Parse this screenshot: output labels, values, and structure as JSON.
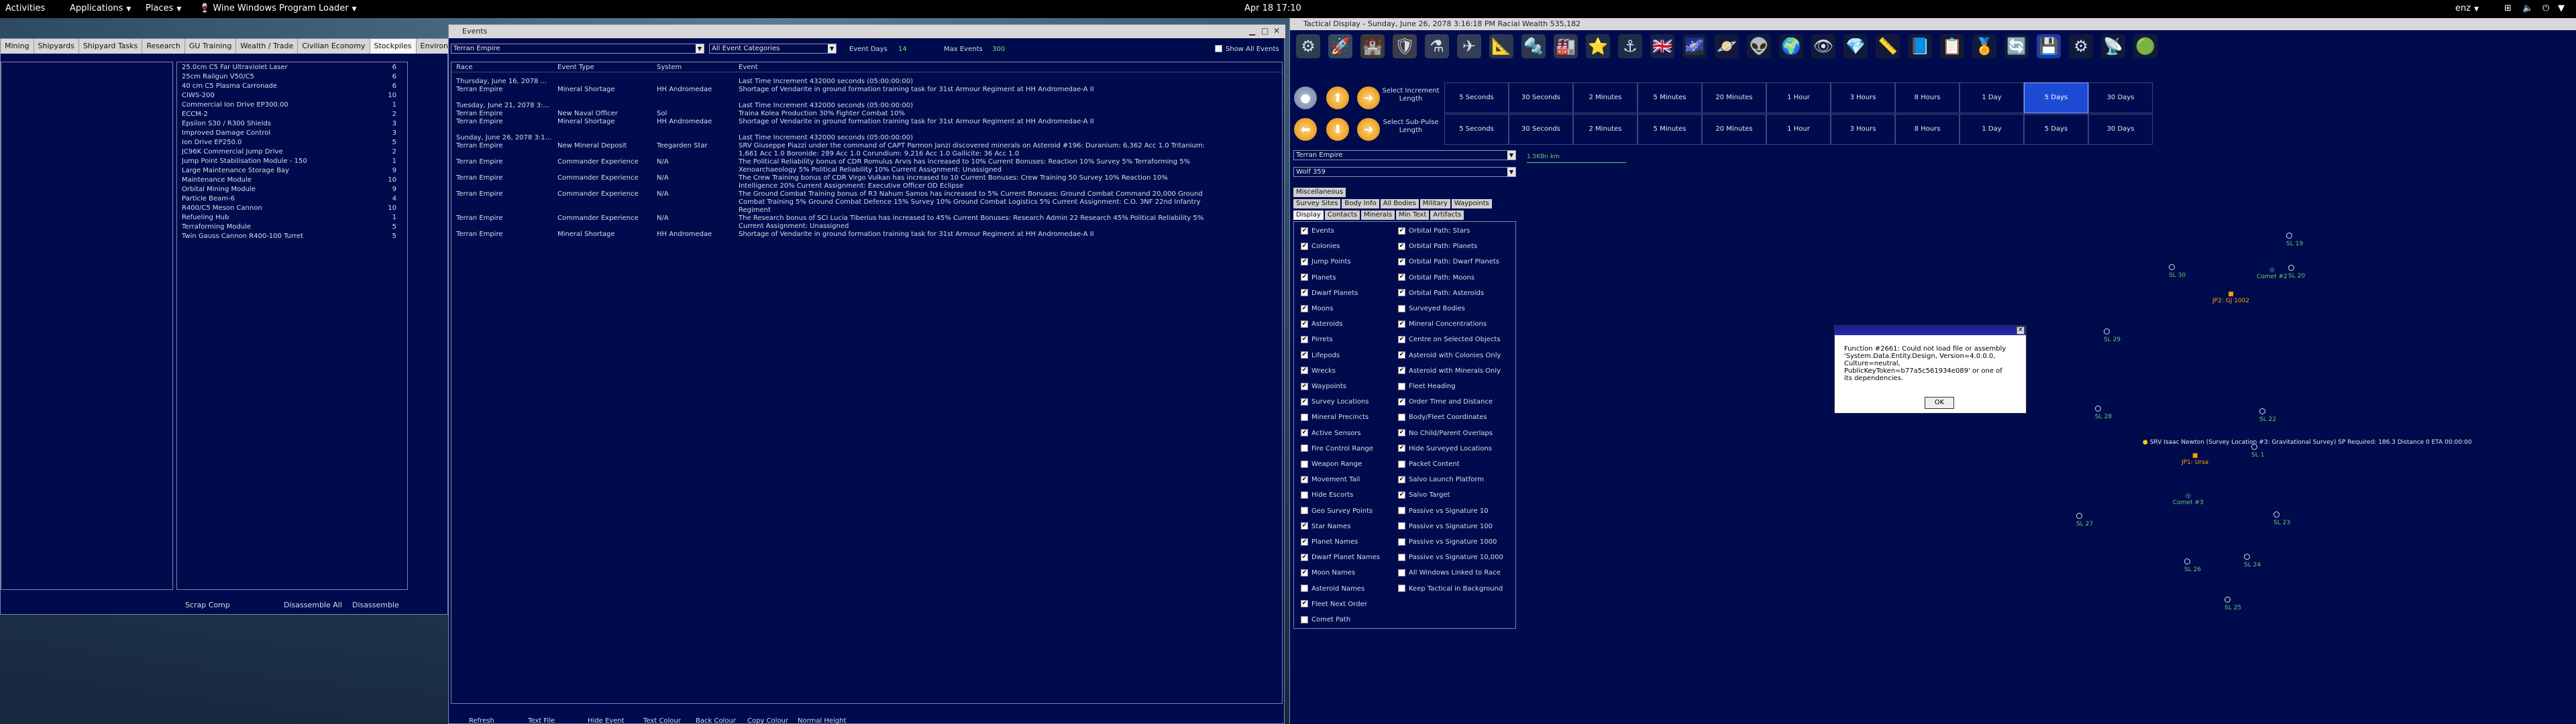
{
  "topbar": {
    "activities": "Activities",
    "applications": "Applications",
    "places": "Places",
    "wine": "Wine Windows Program Loader",
    "clock": "Apr 18  17:10",
    "lang": "enz"
  },
  "left_window": {
    "tabs": [
      "Mining",
      "Shipyards",
      "Shipyard Tasks",
      "Research",
      "GU Training",
      "Wealth / Trade",
      "Civilian Economy",
      "Stockpiles",
      "Environme"
    ],
    "components": [
      {
        "name": "25.0cm C5 Far Ultraviolet Laser",
        "qty": "6"
      },
      {
        "name": "25cm Railgun V50/C5",
        "qty": "6"
      },
      {
        "name": "40 cm C5 Plasma Carronade",
        "qty": "6"
      },
      {
        "name": "CIWS-200",
        "qty": "10"
      },
      {
        "name": "Commercial Ion Drive  EP300.00",
        "qty": "1"
      },
      {
        "name": "ECCM-2",
        "qty": "2"
      },
      {
        "name": "Epsilon S30 / R300 Shields",
        "qty": "3"
      },
      {
        "name": "Improved Damage Control",
        "qty": "3"
      },
      {
        "name": "Ion Drive  EP250.0",
        "qty": "5"
      },
      {
        "name": "JC96K Commercial Jump Drive",
        "qty": "2"
      },
      {
        "name": "Jump Point Stabilisation Module - 150",
        "qty": "1"
      },
      {
        "name": "Large Maintenance Storage Bay",
        "qty": "9"
      },
      {
        "name": "Maintenance Module",
        "qty": "10"
      },
      {
        "name": "Orbital Mining Module",
        "qty": "9"
      },
      {
        "name": "Particle Beam-6",
        "qty": "4"
      },
      {
        "name": "R400/C5 Meson Cannon",
        "qty": "10"
      },
      {
        "name": "Refueling Hub",
        "qty": "1"
      },
      {
        "name": "Terraforming Module",
        "qty": "5"
      },
      {
        "name": "Twin Gauss Cannon R400-100 Turret",
        "qty": "5"
      }
    ],
    "buttons": {
      "scrap": "Scrap Comp",
      "disassemble_all": "Disassemble All",
      "disassemble": "Disassemble"
    }
  },
  "events_window": {
    "title": "Events",
    "race_filter": "Terran Empire",
    "category_filter": "All Event Categories",
    "event_days_label": "Event Days",
    "event_days_value": "14",
    "max_events_label": "Max Events",
    "max_events_value": "300",
    "show_all_label": "Show All Events",
    "columns": {
      "race": "Race",
      "event_type": "Event Type",
      "system": "System",
      "event": "Event"
    },
    "rows": [
      {
        "race": "Thursday, June 16, 2078 ...",
        "type": "",
        "system": "",
        "event": "Last Time Increment 432000 seconds (05:00:00:00)"
      },
      {
        "race": "Terran Empire",
        "type": "Mineral Shortage",
        "system": "HH Andromedae",
        "event": "Shortage of Vendarite in ground formation training task for 31st Armour Regiment at HH Andromedae-A II"
      },
      {
        "race": "",
        "type": "",
        "system": "",
        "event": ""
      },
      {
        "race": "Tuesday, June 21, 2078 3:...",
        "type": "",
        "system": "",
        "event": "Last Time Increment 432000 seconds (05:00:00:00)"
      },
      {
        "race": "Terran Empire",
        "type": "New Naval Officer",
        "system": "Sol",
        "event": "Traina Kolea   Production 30%   Fighter Combat 10%"
      },
      {
        "race": "Terran Empire",
        "type": "Mineral Shortage",
        "system": "HH Andromedae",
        "event": "Shortage of Vendarite in ground formation training task for 31st Armour Regiment at HH Andromedae-A II"
      },
      {
        "race": "",
        "type": "",
        "system": "",
        "event": ""
      },
      {
        "race": "Sunday, June 26, 2078 3:1...",
        "type": "",
        "system": "",
        "event": "Last Time Increment 432000 seconds (05:00:00:00)"
      },
      {
        "race": "Terran Empire",
        "type": "New Mineral Deposit",
        "system": "Teegarden Star",
        "event": "SRV Giuseppe Piazzi under the command of CAPT Parmon Janzi discovered minerals on Asteroid #196:   Duranium: 6,362  Acc 1.0    Tritanium:"
      },
      {
        "race": "",
        "type": "",
        "system": "",
        "event": "1,661  Acc 1.0    Boronide: 289  Acc 1.0    Corundium: 9,216  Acc 1.0    Gallicite: 36  Acc 1.0"
      },
      {
        "race": "Terran Empire",
        "type": "Commander Experience",
        "system": "N/A",
        "event": "The Political Reliability bonus of CDR Romulus Arvis has increased to 10%    Current Bonuses:  Reaction 10%    Survey 5%    Terraforming 5%"
      },
      {
        "race": "",
        "type": "",
        "system": "",
        "event": "Xenoarchaeology 5%    Political Reliability 10%    Current Assignment:  Unassigned"
      },
      {
        "race": "Terran Empire",
        "type": "Commander Experience",
        "system": "N/A",
        "event": "The Crew Training bonus of CDR Virgo Vulkan has increased to 10    Current Bonuses:  Crew Training 50    Survey 10%    Reaction 10%"
      },
      {
        "race": "",
        "type": "",
        "system": "",
        "event": "Intelligence 20%    Current Assignment:  Executive Officer OD Eclipse"
      },
      {
        "race": "Terran Empire",
        "type": "Commander Experience",
        "system": "N/A",
        "event": "The Ground Combat Training bonus of R3 Nahum Samos has increased to 5%    Current Bonuses:  Ground Combat Command 20,000    Ground"
      },
      {
        "race": "",
        "type": "",
        "system": "",
        "event": "Combat Training 5%    Ground Combat Defence 15%    Survey 10%    Ground Combat Logistics 5%    Current Assignment:  C.O. 3NF 22nd Infantry"
      },
      {
        "race": "",
        "type": "",
        "system": "",
        "event": "Regiment"
      },
      {
        "race": "Terran Empire",
        "type": "Commander Experience",
        "system": "N/A",
        "event": "The Research bonus of SCI Lucia Tiberius has increased to 45%    Current Bonuses:  Research Admin 22    Research 45%    Political Reliability 5%"
      },
      {
        "race": "",
        "type": "",
        "system": "",
        "event": "Current Assignment:  Unassigned"
      },
      {
        "race": "Terran Empire",
        "type": "Mineral Shortage",
        "system": "HH Andromedae",
        "event": "Shortage of Vendarite in ground formation training task for 31st Armour Regiment at HH Andromedae-A II"
      }
    ],
    "buttons": [
      "Refresh",
      "Text File",
      "Hide Event",
      "Text Colour",
      "Back Colour",
      "Copy Colour",
      "Normal Height"
    ]
  },
  "tactical_window": {
    "title": "Tactical Display - Sunday, June 26, 2078 3:16:18 PM  Racial Wealth 535,182",
    "increment_label": "Select Increment Length",
    "subpulse_label": "Select Sub-Pulse Length",
    "increments": [
      "5 Seconds",
      "30 Seconds",
      "2 Minutes",
      "5 Minutes",
      "20 Minutes",
      "1 Hour",
      "3 Hours",
      "8 Hours",
      "1 Day",
      "5 Days",
      "30 Days"
    ],
    "selected_increment": "5 Days",
    "race_select": "Terran Empire",
    "system_select": "Wolf 359",
    "scale_label": "1.5KBn km",
    "display_tabs_row1": [
      "Miscellaneous"
    ],
    "display_tabs_row2": [
      "Survey Sites",
      "Body Info",
      "All Bodies",
      "Military",
      "Waypoints"
    ],
    "display_tabs_row3": [
      "Display",
      "Contacts",
      "Minerals",
      "Min Text",
      "Artifacts"
    ],
    "options_left": [
      {
        "label": "Events",
        "checked": true
      },
      {
        "label": "Colonies",
        "checked": true
      },
      {
        "label": "Jump Points",
        "checked": true
      },
      {
        "label": "Planets",
        "checked": true
      },
      {
        "label": "Dwarf Planets",
        "checked": true
      },
      {
        "label": "Moons",
        "checked": true
      },
      {
        "label": "Asteroids",
        "checked": true
      },
      {
        "label": "Pirrets",
        "checked": true
      },
      {
        "label": "Lifepods",
        "checked": true
      },
      {
        "label": "Wrecks",
        "checked": true
      },
      {
        "label": "Waypoints",
        "checked": true
      },
      {
        "label": "Survey Locations",
        "checked": true
      },
      {
        "label": "Mineral Precincts",
        "checked": false
      },
      {
        "label": "Active Sensors",
        "checked": true
      },
      {
        "label": "Fire Control Range",
        "checked": false
      },
      {
        "label": "Weapon Range",
        "checked": false
      },
      {
        "label": "Movement Tail",
        "checked": true
      },
      {
        "label": "Hide Escorts",
        "checked": false
      },
      {
        "label": "Geo Survey Points",
        "checked": false
      },
      {
        "label": "Star Names",
        "checked": true
      },
      {
        "label": "Planet Names",
        "checked": true
      },
      {
        "label": "Dwarf Planet Names",
        "checked": true
      },
      {
        "label": "Moon Names",
        "checked": true
      },
      {
        "label": "Asteroid Names",
        "checked": false
      },
      {
        "label": "Fleet Next Order",
        "checked": true
      },
      {
        "label": "Comet Path",
        "checked": false
      }
    ],
    "options_right": [
      {
        "label": "Orbital Path: Stars",
        "checked": true
      },
      {
        "label": "Orbital Path: Planets",
        "checked": true
      },
      {
        "label": "Orbital Path: Dwarf Planets",
        "checked": true
      },
      {
        "label": "Orbital Path: Moons",
        "checked": true
      },
      {
        "label": "Orbital Path: Asteroids",
        "checked": true
      },
      {
        "label": "Surveyed Bodies",
        "checked": false
      },
      {
        "label": "Mineral Concentrations",
        "checked": true
      },
      {
        "label": "Centre on Selected Objects",
        "checked": true
      },
      {
        "label": "Asteroid with Colonies Only",
        "checked": true
      },
      {
        "label": "Asteroid with Minerals Only",
        "checked": true
      },
      {
        "label": "Fleet Heading",
        "checked": false
      },
      {
        "label": "Order Time and Distance",
        "checked": true
      },
      {
        "label": "Body/Fleet Coordinates",
        "checked": false
      },
      {
        "label": "No Child/Parent Overlaps",
        "checked": true
      },
      {
        "label": "Hide Surveyed Locations",
        "checked": true
      },
      {
        "label": "Packet Content",
        "checked": false
      },
      {
        "label": "Salvo Launch Platform",
        "checked": true
      },
      {
        "label": "Salvo Target",
        "checked": true
      },
      {
        "label": "Passive vs Signature 10",
        "checked": false
      },
      {
        "label": "Passive vs Signature 100",
        "checked": false
      },
      {
        "label": "Passive vs Signature 1000",
        "checked": false
      },
      {
        "label": "Passive vs Signature 10,000",
        "checked": false
      },
      {
        "label": "All Windows Linked to Race",
        "checked": false
      },
      {
        "label": "Keep Tactical in Background",
        "checked": false
      }
    ],
    "map": {
      "survey_locations": [
        "SL 19",
        "SL 30",
        "SL 20",
        "SL 29",
        "SL 28",
        "SL 22",
        "SL 1",
        "SL 27",
        "SL 23",
        "SL 26",
        "SL 24",
        "SL 25"
      ],
      "jump_point_1": "JP2: GJ 1002",
      "jump_point_2": "JP1: Ursa",
      "comet_1": "Comet #2",
      "comet_2": "Comet #3",
      "fleet_label": "SRV Isaac Newton  (Survey Location #3: Gravitational Survey)  SP Required: 186.3   Distance 0   ETA 00:00:00"
    }
  },
  "error_dialog": {
    "message": "Function #2661: Could not load file or assembly 'System.Data.Entity.Design, Version=4.0.0.0, Culture=neutral, PublicKeyToken=b77a5c561934e089' or one of its dependencies.",
    "ok": "OK"
  },
  "colors": {
    "window_bg": "#000b4d",
    "selected_increment": "#1e4bd6",
    "map_green": "#66cc66",
    "jump_point": "#f2a400"
  }
}
